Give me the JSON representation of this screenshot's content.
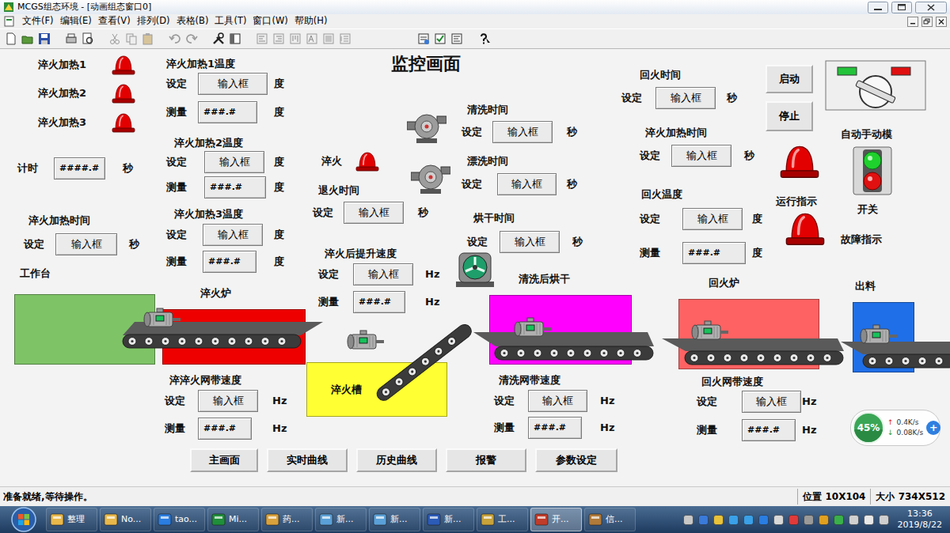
{
  "window": {
    "title": "MCGS组态环境 - [动画组态窗口0]"
  },
  "menu": [
    "文件(F)",
    "编辑(E)",
    "查看(V)",
    "排列(D)",
    "表格(B)",
    "工具(T)",
    "窗口(W)",
    "帮助(H)"
  ],
  "screen": {
    "title": "监控画面",
    "heat_lamps": [
      {
        "label": "淬火加热1"
      },
      {
        "label": "淬火加热2"
      },
      {
        "label": "淬火加热3"
      }
    ],
    "timer": {
      "label": "计时",
      "value": "####.#",
      "unit": "秒"
    },
    "quench_lamp": {
      "label": "淬火"
    },
    "param_groups": [
      {
        "title": "淬火加热1温度",
        "rows": [
          {
            "label": "设定",
            "value": "输入框",
            "unit": "度",
            "kind": "input"
          },
          {
            "label": "测量",
            "value": "###.#",
            "unit": "度",
            "kind": "display"
          }
        ]
      },
      {
        "title": "淬火加热2温度",
        "rows": [
          {
            "label": "设定",
            "value": "输入框",
            "unit": "度",
            "kind": "input"
          },
          {
            "label": "测量",
            "value": "###.#",
            "unit": "度",
            "kind": "display"
          }
        ]
      },
      {
        "title": "淬火加热3温度",
        "rows": [
          {
            "label": "设定",
            "value": "输入框",
            "unit": "度",
            "kind": "input"
          },
          {
            "label": "测量",
            "value": "###.#",
            "unit": "度",
            "kind": "display"
          }
        ]
      },
      {
        "title": "淬火加热时间",
        "rows": [
          {
            "label": "设定",
            "value": "输入框",
            "unit": "秒",
            "kind": "input"
          }
        ]
      },
      {
        "title": "清洗时间",
        "rows": [
          {
            "label": "设定",
            "value": "输入框",
            "unit": "秒",
            "kind": "input"
          }
        ]
      },
      {
        "title": "漂洗时间",
        "rows": [
          {
            "label": "设定",
            "value": "输入框",
            "unit": "秒",
            "kind": "input"
          }
        ]
      },
      {
        "title": "退火时间",
        "rows": [
          {
            "label": "设定",
            "value": "输入框",
            "unit": "秒",
            "kind": "input"
          }
        ]
      },
      {
        "title": "烘干时间",
        "rows": [
          {
            "label": "设定",
            "value": "输入框",
            "unit": "秒",
            "kind": "input"
          }
        ]
      },
      {
        "title": "淬火后提升速度",
        "rows": [
          {
            "label": "设定",
            "value": "输入框",
            "unit": "Hz",
            "kind": "input"
          },
          {
            "label": "测量",
            "value": "###.#",
            "unit": "Hz",
            "kind": "display"
          }
        ]
      },
      {
        "title": "回火时间",
        "rows": [
          {
            "label": "设定",
            "value": "输入框",
            "unit": "秒",
            "kind": "input"
          }
        ]
      },
      {
        "title": "淬火加热时间",
        "rows": [
          {
            "label": "设定",
            "value": "输入框",
            "unit": "秒",
            "kind": "input"
          }
        ]
      },
      {
        "title": "回火温度",
        "rows": [
          {
            "label": "设定",
            "value": "输入框",
            "unit": "度",
            "kind": "input"
          },
          {
            "label": "测量",
            "value": "###.#",
            "unit": "度",
            "kind": "display"
          }
        ]
      },
      {
        "title": "淬淬火网带速度",
        "rows": [
          {
            "label": "设定",
            "value": "输入框",
            "unit": "Hz",
            "kind": "input"
          },
          {
            "label": "测量",
            "value": "###.#",
            "unit": "Hz",
            "kind": "display"
          }
        ]
      },
      {
        "title": "清洗网带速度",
        "rows": [
          {
            "label": "设定",
            "value": "输入框",
            "unit": "Hz",
            "kind": "input"
          },
          {
            "label": "测量",
            "value": "###.#",
            "unit": "Hz",
            "kind": "display"
          }
        ]
      },
      {
        "title": "回火网带速度",
        "rows": [
          {
            "label": "设定",
            "value": "输入框",
            "unit": "Hz",
            "kind": "input"
          },
          {
            "label": "测量",
            "value": "###.#",
            "unit": "Hz",
            "kind": "display"
          }
        ]
      }
    ],
    "buttons": [
      "启动",
      "停止"
    ],
    "mode": {
      "label": "自动手动模",
      "switch_label": "开关"
    },
    "indicators": [
      {
        "label": "运行指示"
      },
      {
        "label": "故障指示"
      }
    ],
    "stations": [
      {
        "label": "工作台",
        "color": "#7ec466",
        "kind": "above"
      },
      {
        "label": "淬火炉",
        "color": "#ee0000",
        "kind": "above"
      },
      {
        "label": "淬火槽",
        "color": "#ffff33",
        "kind": "inside"
      },
      {
        "label": "清洗后烘干",
        "color": "#ff00ff",
        "kind": "above"
      },
      {
        "label": "回火炉",
        "color": "#ff6262",
        "kind": "above"
      },
      {
        "label": "出料",
        "color": "#1f6fe8",
        "kind": "above"
      }
    ],
    "nav": [
      "主画面",
      "实时曲线",
      "历史曲线",
      "报警",
      "参数设定"
    ]
  },
  "net_meter": {
    "percent": "45%",
    "level": 0.45,
    "up_icon": "↑",
    "up": "0.4K/s",
    "down_icon": "↓",
    "down": "0.08K/s",
    "expand_icon": "+"
  },
  "status_bar": {
    "message": "准备就绪,等待操作。",
    "position": "位置 10X104",
    "size": "大小 734X512"
  },
  "taskbar": {
    "items": [
      {
        "label": "整理",
        "selected": false
      },
      {
        "label": "No...",
        "selected": false
      },
      {
        "label": "tao...",
        "selected": false
      },
      {
        "label": "Mi...",
        "selected": false
      },
      {
        "label": "药...",
        "selected": false
      },
      {
        "label": "新...",
        "selected": false
      },
      {
        "label": "新...",
        "selected": false
      },
      {
        "label": "新...",
        "selected": false
      },
      {
        "label": "工...",
        "selected": false
      },
      {
        "label": "开...",
        "selected": true
      },
      {
        "label": "信...",
        "selected": false
      }
    ],
    "time": "13:36",
    "date": "2019/8/22"
  }
}
